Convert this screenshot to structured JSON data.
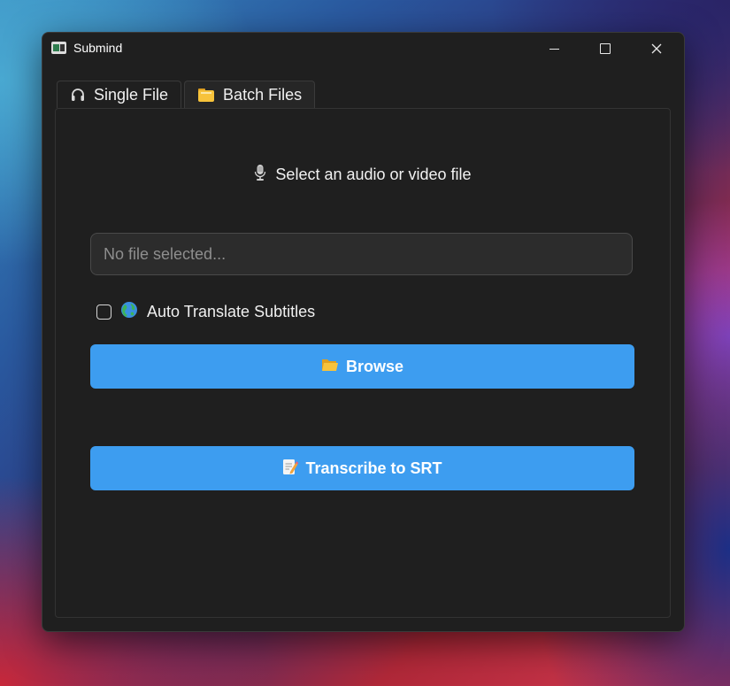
{
  "window": {
    "title": "Submind",
    "controls": {
      "minimize": "minimize",
      "maximize": "maximize",
      "close": "close"
    }
  },
  "tabs": [
    {
      "label": "Single File",
      "icon": "headphones-icon",
      "active": true
    },
    {
      "label": "Batch Files",
      "icon": "folder-icon",
      "active": false
    }
  ],
  "main": {
    "heading": "Select an audio or video file",
    "heading_icon": "microphone-icon",
    "file_input": {
      "value": "",
      "placeholder": "No file selected..."
    },
    "auto_translate": {
      "label": "Auto Translate Subtitles",
      "checked": false,
      "icon": "globe-icon"
    },
    "browse_button": {
      "label": "Browse",
      "icon": "open-folder-icon"
    },
    "transcribe_button": {
      "label": "Transcribe to SRT",
      "icon": "memo-icon"
    }
  },
  "colors": {
    "accent": "#3d9df0",
    "window_bg": "#1f1f1f",
    "input_bg": "#2c2c2c"
  }
}
